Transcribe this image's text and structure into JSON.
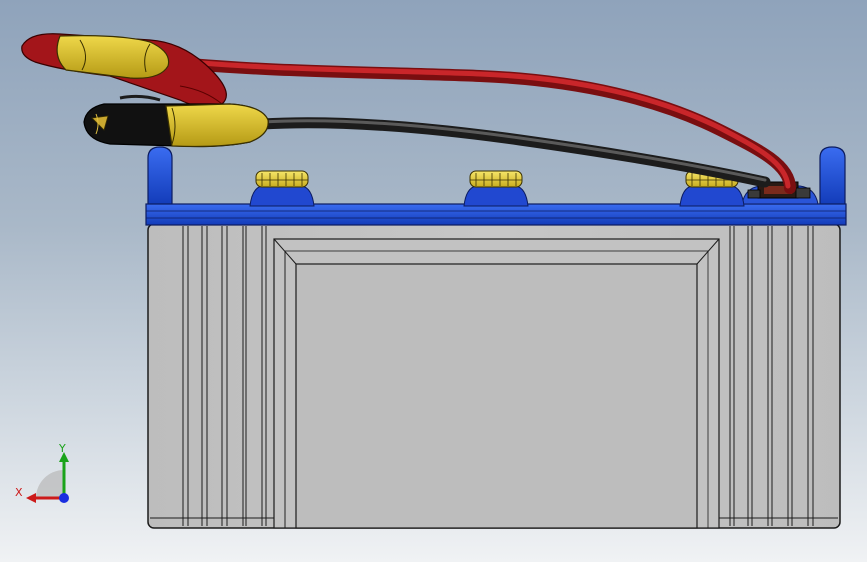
{
  "viewport": {
    "background_top": "#8fa3bb",
    "background_bottom": "#f0f2f4"
  },
  "model": {
    "parts": [
      {
        "name": "battery-case",
        "color": "#c3c3c3"
      },
      {
        "name": "battery-lid",
        "color": "#1f4fd6"
      },
      {
        "name": "vent-caps",
        "count": 3,
        "color": "#e8d23a"
      },
      {
        "name": "positive-clamp-cable",
        "color": "#b3181c"
      },
      {
        "name": "negative-clamp-cable",
        "color": "#2a2a2a"
      },
      {
        "name": "clamp-grips",
        "color": "#d8c02a"
      }
    ]
  },
  "triad": {
    "x_label": "X",
    "y_label": "Y",
    "x_color": "#cc1a1a",
    "y_color": "#1aa31a",
    "z_color": "#1a2ee0"
  }
}
